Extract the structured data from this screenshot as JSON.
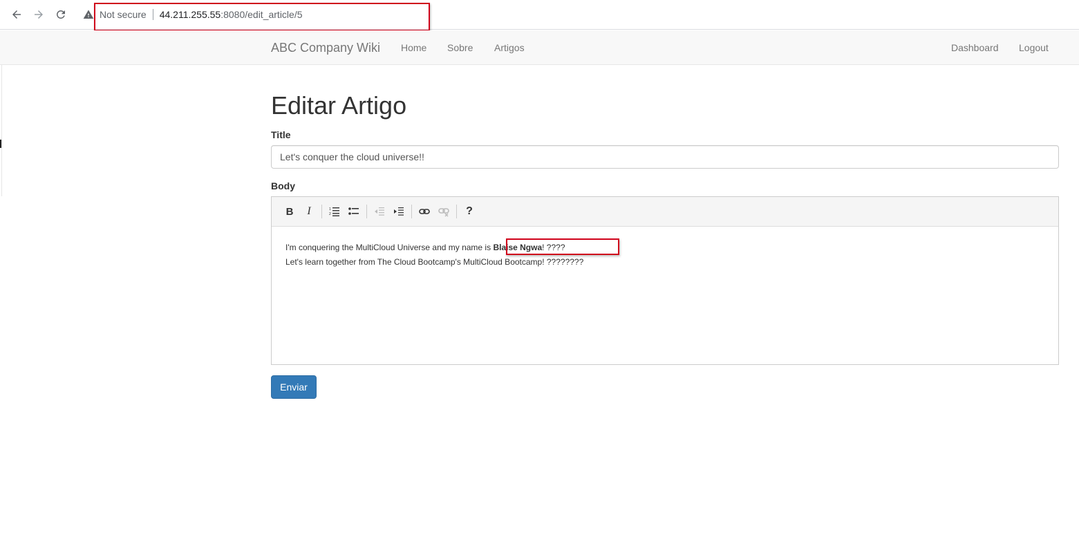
{
  "browser": {
    "security_label": "Not secure",
    "url_host": "44.211.255.55",
    "url_rest": ":8080/edit_article/5"
  },
  "navbar": {
    "brand": "ABC Company Wiki",
    "links": [
      "Home",
      "Sobre",
      "Artigos"
    ],
    "right_links": [
      "Dashboard",
      "Logout"
    ]
  },
  "page": {
    "heading": "Editar Artigo",
    "title_label": "Title",
    "title_value": "Let's conquer the cloud universe!!",
    "body_label": "Body",
    "body_line1_prefix": "I'm conquering the MultiCloud Universe and my name is ",
    "body_line1_bold": "Blaise Ngwa",
    "body_line1_suffix": "! ????",
    "body_line2": "Let's learn together from The Cloud Bootcamp's MultiCloud Bootcamp! ????????",
    "submit_label": "Enviar"
  },
  "toolbar": {
    "bold": "B",
    "italic": "I",
    "help": "?",
    "icons": [
      "ordered-list-icon",
      "unordered-list-icon",
      "outdent-icon",
      "indent-icon",
      "link-icon",
      "unlink-icon"
    ]
  },
  "colors": {
    "primary": "#337ab7",
    "annotation": "#d0021b",
    "navbar_bg": "#f8f8f8"
  }
}
